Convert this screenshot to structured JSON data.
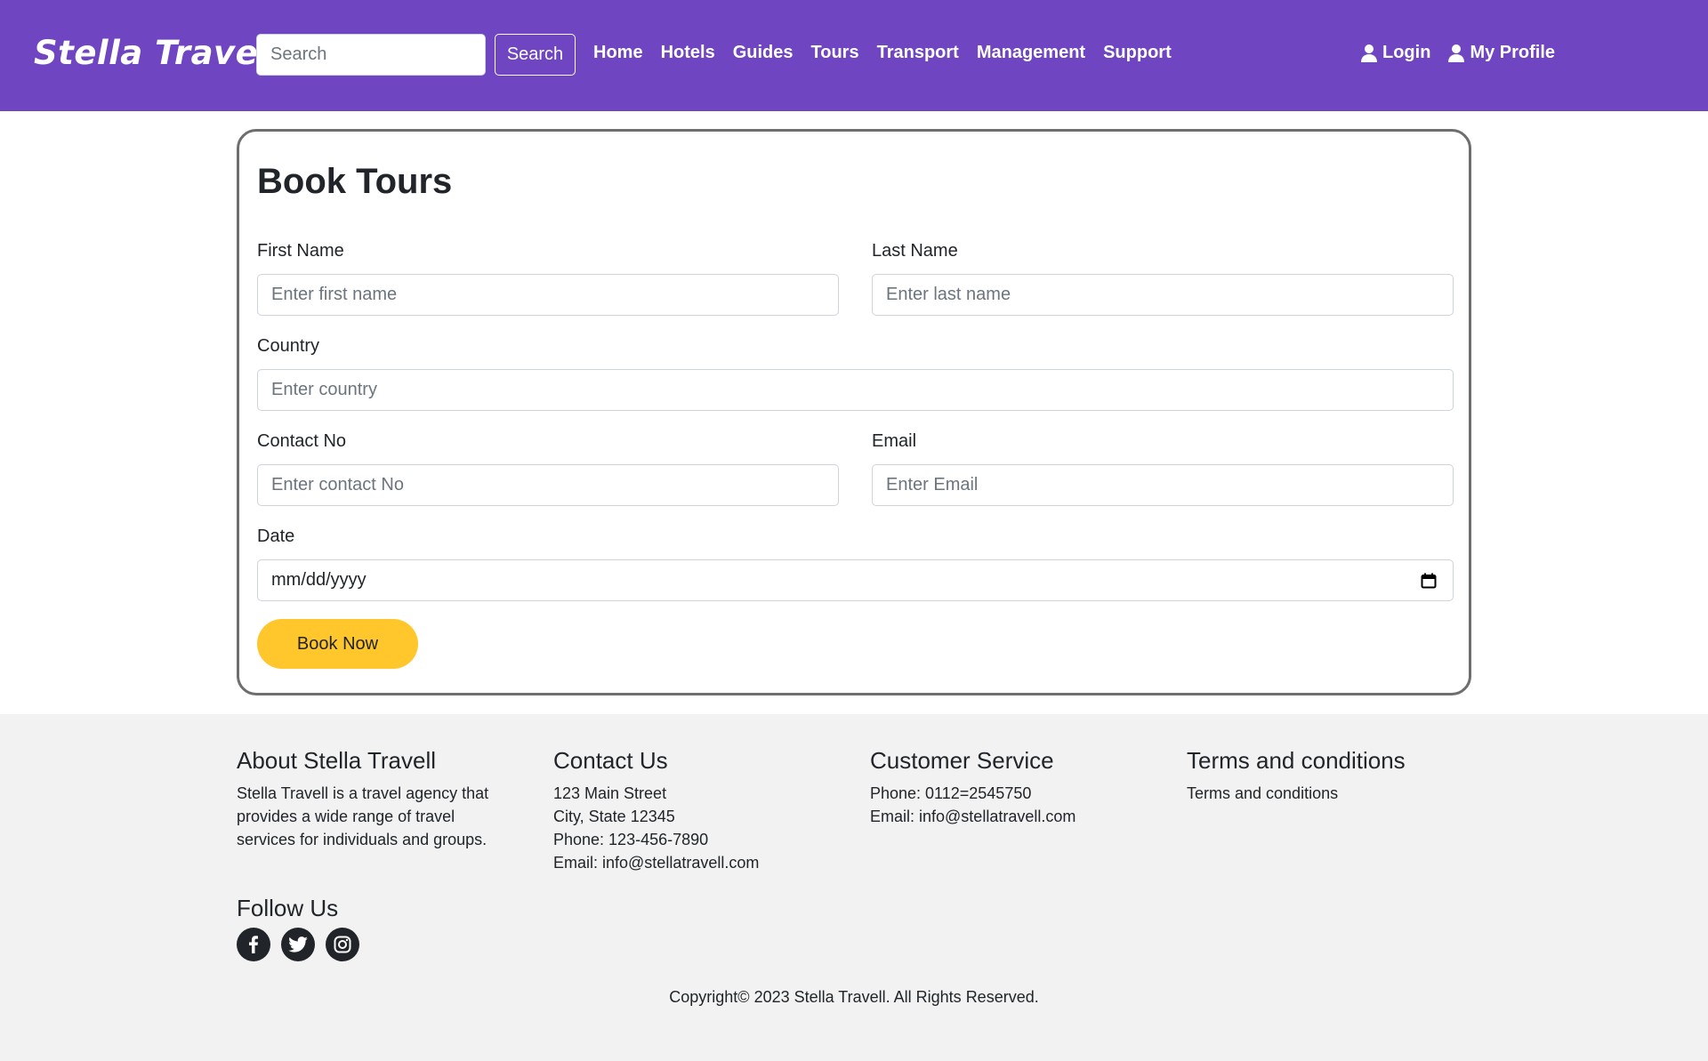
{
  "navbar": {
    "brand": "Stella Travel",
    "search_placeholder": "Search",
    "search_button": "Search",
    "links": [
      "Home",
      "Hotels",
      "Guides",
      "Tours",
      "Transport",
      "Management",
      "Support"
    ],
    "login": "Login",
    "profile": "My Profile",
    "color": "#6f45c2"
  },
  "form": {
    "title": "Book Tours",
    "first_name_label": "First Name",
    "first_name_placeholder": "Enter first name",
    "last_name_label": "Last Name",
    "last_name_placeholder": "Enter last name",
    "country_label": "Country",
    "country_placeholder": "Enter country",
    "contact_label": "Contact No",
    "contact_placeholder": "Enter contact No",
    "email_label": "Email",
    "email_placeholder": "Enter Email",
    "date_label": "Date",
    "date_value": "mm/dd/yyyy",
    "submit": "Book Now",
    "submit_color": "#ffc72c"
  },
  "footer": {
    "about_title": "About Stella Travell",
    "about_text": "Stella Travell is a travel agency that provides a wide range of travel services for individuals and groups.",
    "contact_title": "Contact Us",
    "contact_lines": [
      "123 Main Street",
      "City, State 12345",
      "Phone: 123-456-7890",
      "Email: info@stellatravell.com"
    ],
    "service_title": "Customer Service",
    "service_lines": [
      "Phone: 0112=2545750",
      "Email: info@stellatravell.com"
    ],
    "terms_title": "Terms and conditions",
    "terms_link": "Terms and conditions",
    "follow_title": "Follow Us",
    "social_icons": [
      "facebook-icon",
      "twitter-icon",
      "instagram-icon"
    ],
    "copyright": "Copyright© 2023 Stella Travell. All Rights Reserved."
  }
}
